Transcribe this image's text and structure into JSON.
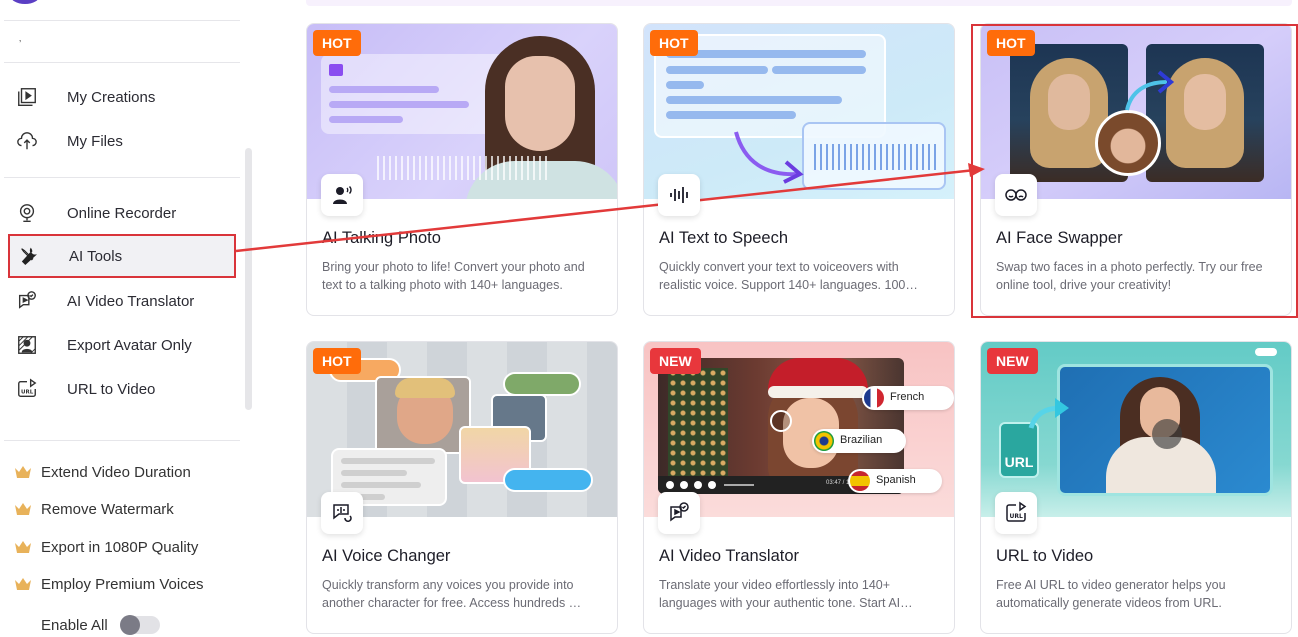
{
  "sidebar": {
    "nav_group_1": [
      {
        "label": "My Creations",
        "icon": "play-stack-icon"
      },
      {
        "label": "My Files",
        "icon": "cloud-upload-icon"
      }
    ],
    "nav_group_2": [
      {
        "label": "Online Recorder",
        "icon": "webcam-icon"
      },
      {
        "label": "AI Tools",
        "icon": "tools-icon",
        "active": true
      },
      {
        "label": "AI Video Translator",
        "icon": "video-translate-icon"
      },
      {
        "label": "Export Avatar Only",
        "icon": "avatar-export-icon"
      },
      {
        "label": "URL to Video",
        "icon": "url-video-icon"
      }
    ],
    "perks": [
      {
        "label": "Extend Video Duration",
        "icon": "crown-icon"
      },
      {
        "label": "Remove Watermark",
        "icon": "crown-icon"
      },
      {
        "label": "Export in 1080P Quality",
        "icon": "crown-icon"
      },
      {
        "label": "Employ Premium Voices",
        "icon": "crown-icon"
      }
    ],
    "enable_all": {
      "label": "Enable All",
      "on": false
    }
  },
  "cards": [
    {
      "badge": "HOT",
      "title": "AI Talking Photo",
      "desc": "Bring your photo to life! Convert your photo and text to a talking photo with 140+ languages.",
      "icon": "talking-head-icon"
    },
    {
      "badge": "HOT",
      "title": "AI Text to Speech",
      "desc": "Quickly convert your text to voiceovers with realistic voice. Support 140+ languages. 100…",
      "icon": "soundwave-icon"
    },
    {
      "badge": "HOT",
      "title": "AI Face Swapper",
      "desc": "Swap two faces in a photo perfectly. Try our free online tool, drive your creativity!",
      "icon": "face-swap-icon"
    },
    {
      "badge": "HOT",
      "title": "AI Voice Changer",
      "desc": "Quickly transform any voices you provide into another character for free. Access hundreds …",
      "icon": "voice-change-icon"
    },
    {
      "badge": "NEW",
      "title": "AI Video Translator",
      "desc": "Translate your video effortlessly into 140+ languages with your authentic tone. Start AI…",
      "icon": "video-translate-icon"
    },
    {
      "badge": "NEW",
      "title": "URL to Video",
      "desc": "Free AI URL to video generator helps you automatically generate videos from URL.",
      "icon": "url-video-icon"
    }
  ],
  "thumb_text": {
    "translator_langs": [
      "French",
      "Brazilian",
      "Spanish"
    ],
    "translator_time": "03:47 / 1…",
    "url_label": "URL"
  },
  "colors": {
    "hot": "#ff6c0a",
    "new": "#e8373c",
    "annotation": "#d9343a"
  }
}
